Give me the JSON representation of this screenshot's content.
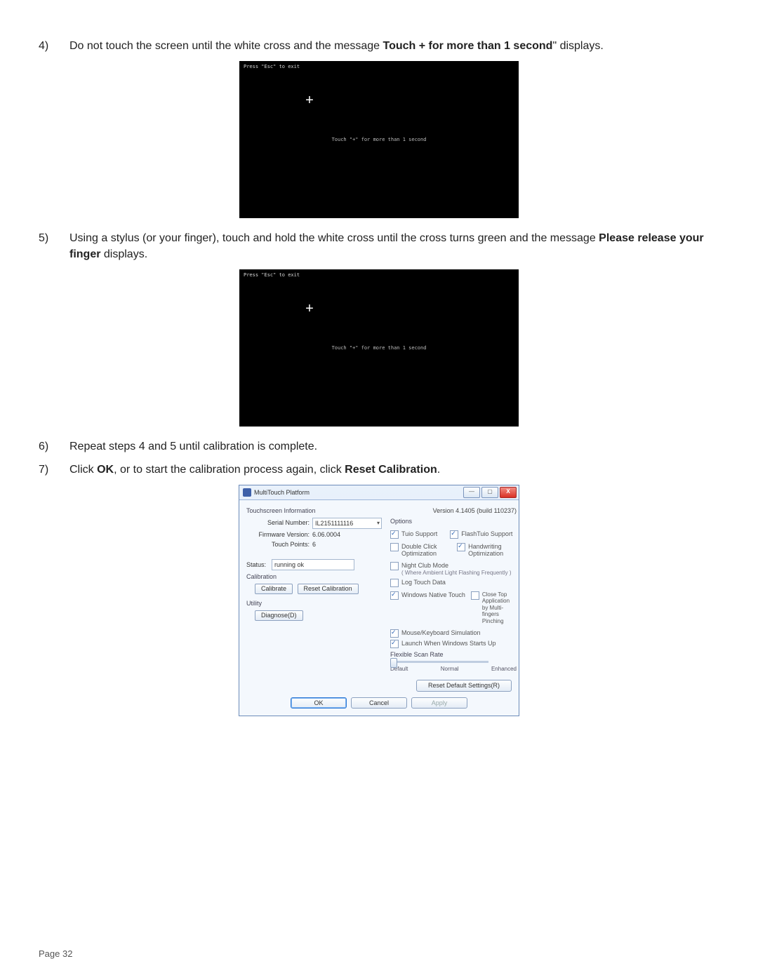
{
  "steps": {
    "s4": {
      "num": "4)",
      "pre": "Do not touch the screen until the white cross and the message ",
      "bold": "Touch + for more than 1 second",
      "post": "\" displays."
    },
    "s5": {
      "num": "5)",
      "pre": "Using a stylus (or your finger), touch and hold the white cross until the cross turns green and the message ",
      "bold": "Please release your finger",
      "post": " displays."
    },
    "s6": {
      "num": "6)",
      "text": "Repeat steps 4 and 5 until calibration is complete."
    },
    "s7": {
      "num": "7)",
      "pre": "Click ",
      "b1": "OK",
      "mid": ", or to start the calibration process again, click ",
      "b2": "Reset Calibration",
      "post": "."
    }
  },
  "cal": {
    "esc": "Press \"Esc\" to exit",
    "cross": "+",
    "msg": "Touch \"+\" for more than 1 second"
  },
  "dlg": {
    "title": "MultiTouch Platform",
    "minimize": "—",
    "maximize": "▢",
    "close": "X",
    "version": "Version 4.1405 (build 110237)",
    "left": {
      "group_info": "Touchscreen Information",
      "serial_label": "Serial Number:",
      "serial_value": "IL2151111116",
      "fw_label": "Firmware Version:",
      "fw_value": "6.06.0004",
      "tp_label": "Touch Points:",
      "tp_value": "6",
      "status_label": "Status:",
      "status_value": "running ok",
      "calibration_head": "Calibration",
      "btn_calibrate": "Calibrate",
      "btn_reset": "Reset Calibration",
      "utility_head": "Utility",
      "btn_diagnose": "Diagnose(D)"
    },
    "right": {
      "options_head": "Options",
      "tuio": "Tuio Support",
      "flashtuio": "FlashTuio Support",
      "dbl": "Double Click Optimization",
      "hand": "Handwriting Optimization",
      "night": "Night Club Mode",
      "night_sub": "( Where Ambient Light Flashing Frequently )",
      "log": "Log Touch Data",
      "wnt": "Windows Native Touch",
      "closeTop": "Close Top Application by Multi-fingers Pinching",
      "mks": "Mouse/Keyboard Simulation",
      "launch": "Launch When Windows Starts Up",
      "flex": "Flexible Scan Rate",
      "s_default": "Default",
      "s_normal": "Normal",
      "s_enhanced": "Enhanced"
    },
    "footer": {
      "reset": "Reset Default Settings(R)",
      "ok": "OK",
      "cancel": "Cancel",
      "apply": "Apply"
    }
  },
  "page_footer": "Page 32"
}
